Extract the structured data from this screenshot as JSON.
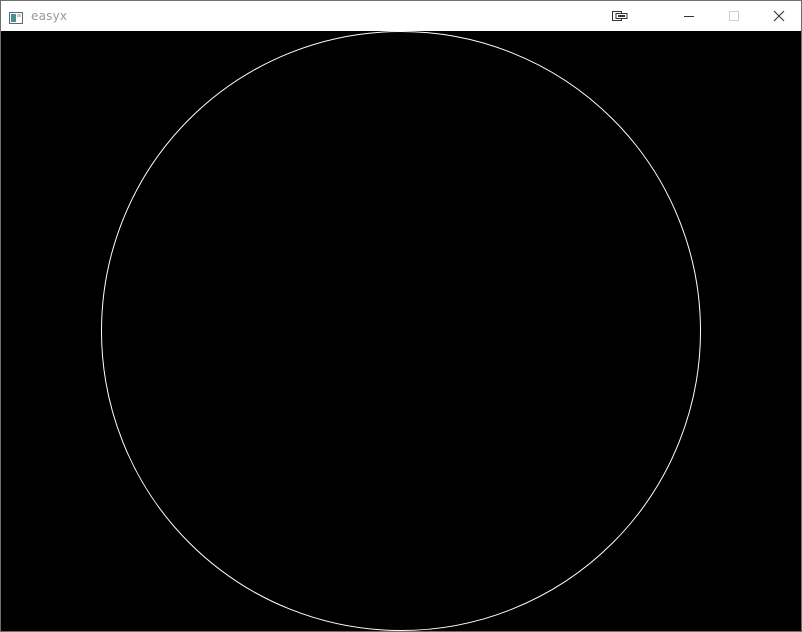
{
  "window": {
    "title": "easyx",
    "buttons": {
      "extra": "window-pin-icon",
      "minimize": "minimize-icon",
      "maximize": "maximize-icon",
      "close": "close-icon"
    }
  },
  "canvas": {
    "background_color": "#000000",
    "shape": "circle",
    "stroke_color": "#ffffff"
  }
}
